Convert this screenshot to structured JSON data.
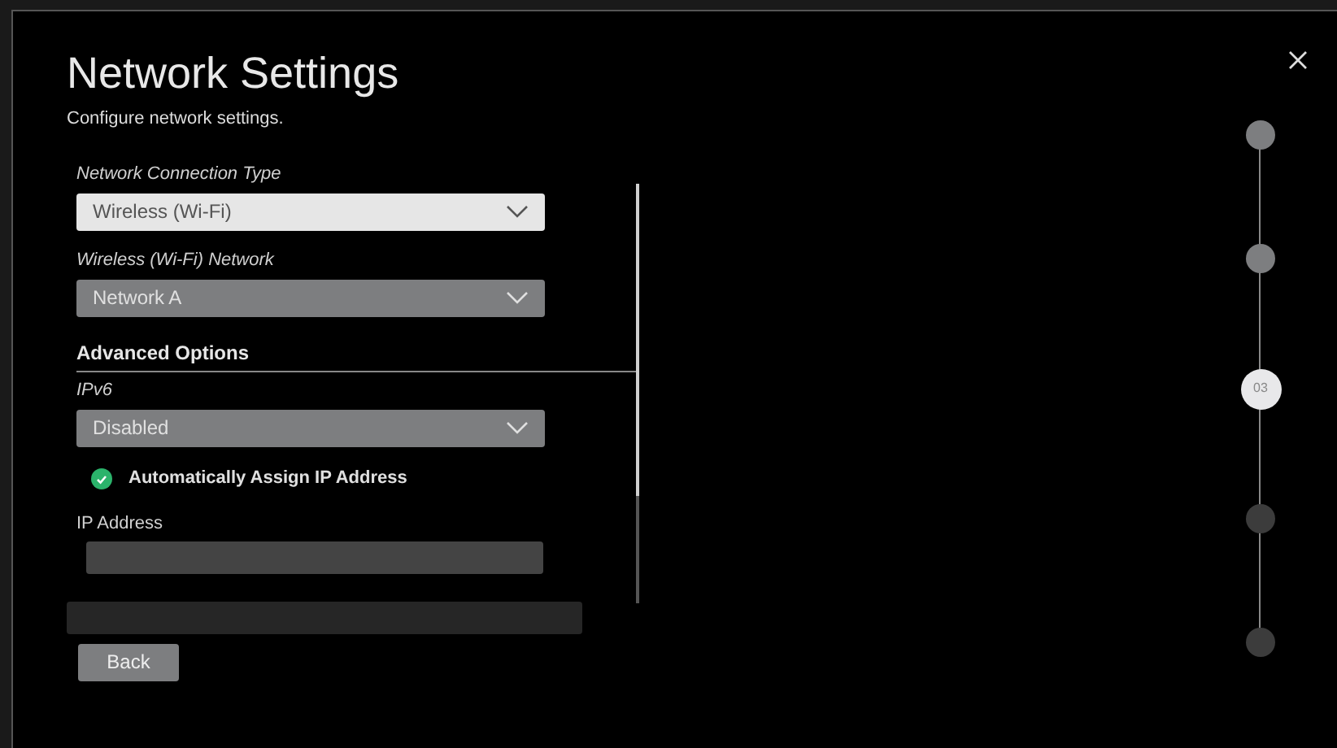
{
  "header": {
    "title": "Network Settings",
    "subtitle": "Configure network settings."
  },
  "fields": [
    {
      "kind": "dropdown",
      "label": "Network Connection Type",
      "value": "Wireless (Wi-Fi)",
      "focused": true
    },
    {
      "kind": "dropdown",
      "label": "Wireless (Wi-Fi) Network",
      "value": "Network A",
      "focused": false
    }
  ],
  "advanced": {
    "title": "Advanced Options",
    "items": [
      {
        "kind": "dropdown",
        "label": "IPv6",
        "value": "Disabled",
        "focused": false
      },
      {
        "kind": "checkbox",
        "label": "Automatically Assign IP Address",
        "checked": true
      },
      {
        "kind": "input",
        "label": "IP Address"
      }
    ]
  },
  "back_button": "Back",
  "steps": [
    {
      "selected": false,
      "color": "#7d7e80"
    },
    {
      "selected": false,
      "color": "#7d7e80"
    },
    {
      "selected": true,
      "color": "#e8e8ea",
      "label": "03"
    },
    {
      "selected": false,
      "color": "#3c3c3c"
    },
    {
      "selected": false,
      "color": "#3c3c3c"
    }
  ]
}
